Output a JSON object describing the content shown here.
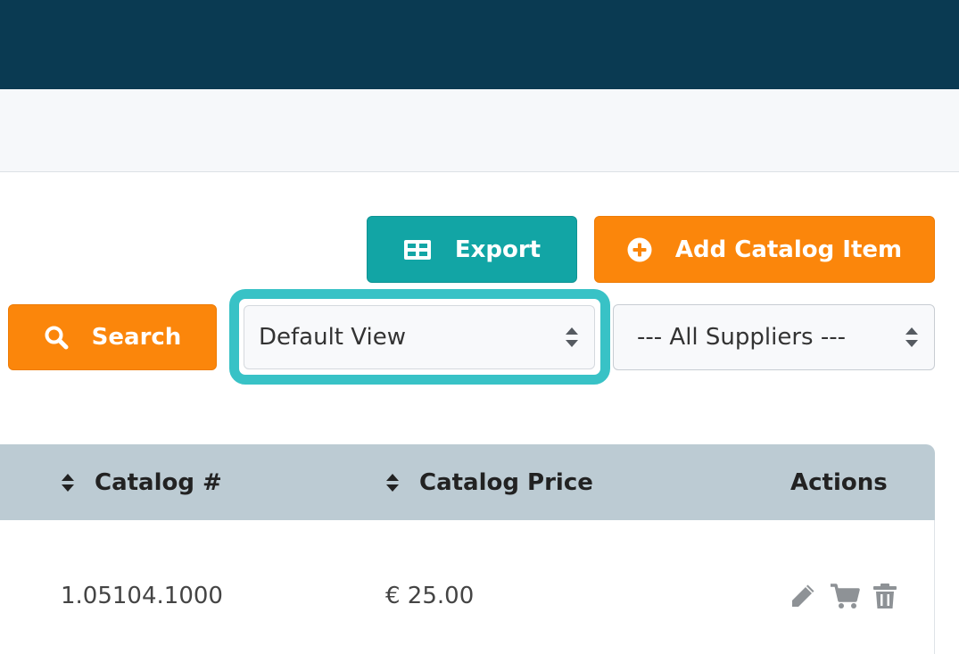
{
  "toolbar": {
    "export_label": "Export",
    "add_label": "Add Catalog Item",
    "search_label": "Search"
  },
  "filters": {
    "view_selected": "Default View",
    "supplier_selected": "--- All Suppliers ---"
  },
  "table": {
    "columns": [
      "Catalog #",
      "Catalog Price",
      "Actions"
    ],
    "rows": [
      {
        "catalog_number": "1.05104.1000",
        "catalog_price": "€ 25.00"
      }
    ]
  },
  "icons": {
    "export": "table-grid-icon",
    "add": "plus-circle-icon",
    "search": "search-icon",
    "sort": "sort-icon",
    "edit": "pencil-icon",
    "cart": "cart-icon",
    "delete": "trash-icon"
  },
  "colors": {
    "header_bar": "#0a3a52",
    "teal": "#12a5a5",
    "orange": "#fb860b",
    "focus_ring": "#38c2c6",
    "table_header": "#bccbd3"
  }
}
